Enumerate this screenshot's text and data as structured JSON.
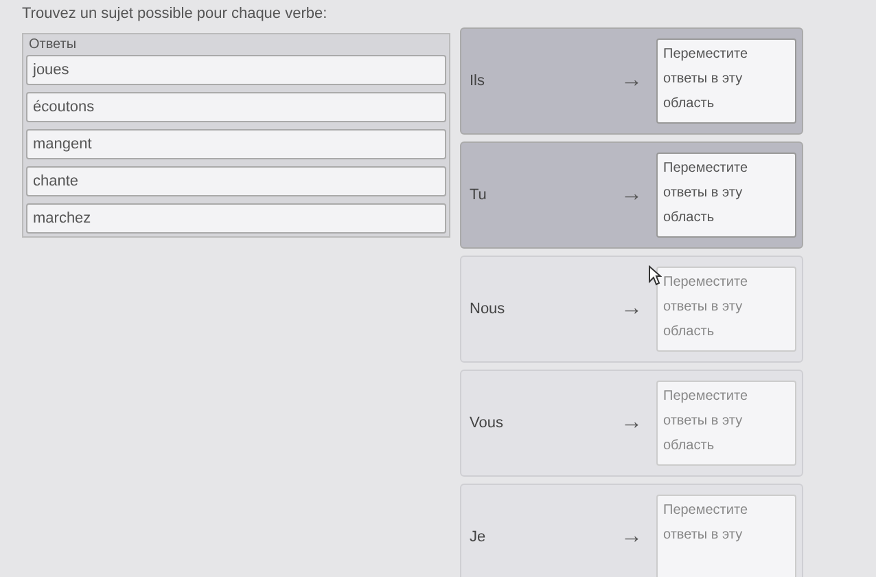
{
  "instruction": "Trouvez un sujet possible pour chaque verbe:",
  "answers": {
    "title": "Ответы",
    "items": [
      "joues",
      "écoutons",
      "mangent",
      "chante",
      "marchez"
    ]
  },
  "rows": [
    {
      "subject": "Ils",
      "arrow": "→",
      "drop": "Переместите ответы в эту область"
    },
    {
      "subject": "Tu",
      "arrow": "→",
      "drop": "Переместите ответы в эту область"
    },
    {
      "subject": "Nous",
      "arrow": "→",
      "drop": "Переместите ответы в эту область"
    },
    {
      "subject": "Vous",
      "arrow": "→",
      "drop": "Переместите ответы в эту область"
    },
    {
      "subject": "Je",
      "arrow": "→",
      "drop": "Переместите ответы в эту"
    }
  ]
}
